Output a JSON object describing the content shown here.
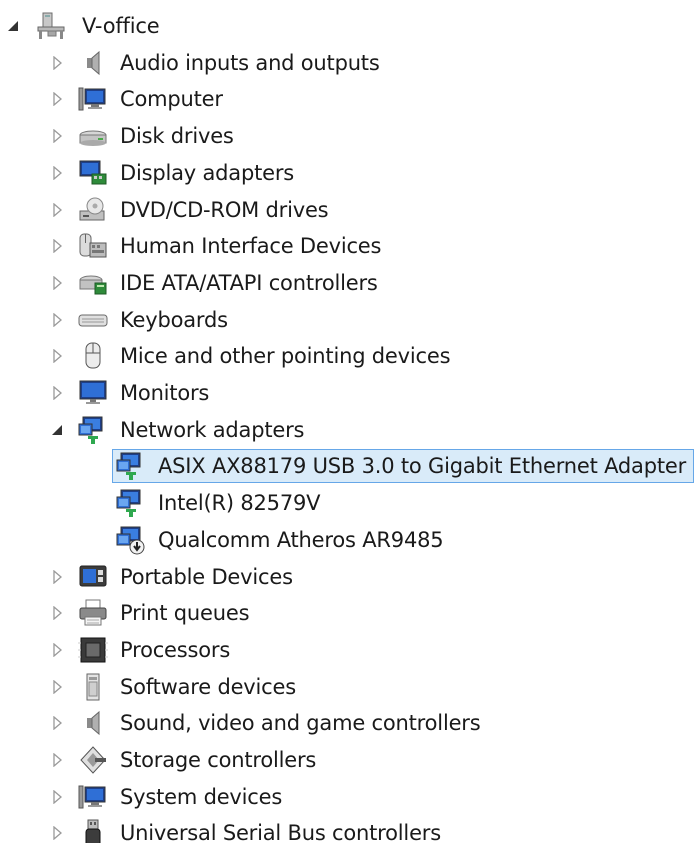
{
  "tree": {
    "root": {
      "label": "V-office",
      "icon": "computer-desk-icon",
      "expanded": true
    },
    "categories": [
      {
        "label": "Audio inputs and outputs",
        "icon": "speaker-icon"
      },
      {
        "label": "Computer",
        "icon": "computer-icon"
      },
      {
        "label": "Disk drives",
        "icon": "disk-drive-icon"
      },
      {
        "label": "Display adapters",
        "icon": "display-adapter-icon"
      },
      {
        "label": "DVD/CD-ROM drives",
        "icon": "dvd-drive-icon"
      },
      {
        "label": "Human Interface Devices",
        "icon": "hid-icon"
      },
      {
        "label": "IDE ATA/ATAPI controllers",
        "icon": "ide-controller-icon"
      },
      {
        "label": "Keyboards",
        "icon": "keyboard-icon"
      },
      {
        "label": "Mice and other pointing devices",
        "icon": "mouse-icon"
      },
      {
        "label": "Monitors",
        "icon": "monitor-icon"
      },
      {
        "label": "Network adapters",
        "icon": "network-adapter-icon",
        "expanded": true,
        "children": [
          {
            "label": "ASIX AX88179 USB 3.0 to Gigabit Ethernet Adapter",
            "icon": "network-adapter-icon",
            "selected": true
          },
          {
            "label": "Intel(R) 82579V",
            "icon": "network-adapter-icon"
          },
          {
            "label": "Qualcomm Atheros AR9485",
            "icon": "network-adapter-warning-icon"
          }
        ]
      },
      {
        "label": "Portable Devices",
        "icon": "portable-device-icon"
      },
      {
        "label": "Print queues",
        "icon": "printer-icon"
      },
      {
        "label": "Processors",
        "icon": "processor-icon"
      },
      {
        "label": "Software devices",
        "icon": "software-device-icon"
      },
      {
        "label": "Sound, video and game controllers",
        "icon": "speaker-icon"
      },
      {
        "label": "Storage controllers",
        "icon": "storage-controller-icon"
      },
      {
        "label": "System devices",
        "icon": "system-device-icon"
      },
      {
        "label": "Universal Serial Bus controllers",
        "icon": "usb-icon"
      }
    ]
  },
  "colors": {
    "selection_border": "#66a7e8",
    "selection_fill": "#d9ebf9",
    "twisty": "#9a9a9a",
    "twisty_expanded": "#333333"
  }
}
